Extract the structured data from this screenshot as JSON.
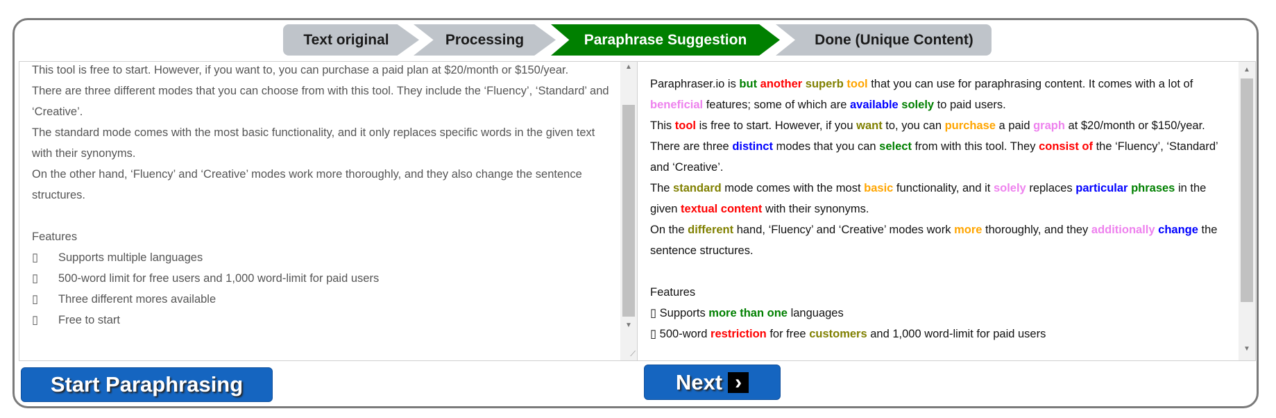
{
  "steps": [
    "Text original",
    "Processing",
    "Paraphrase Suggestion",
    "Done (Unique Content)"
  ],
  "active_step": 2,
  "colors": {
    "green": "#008000",
    "red": "#ff0000",
    "olive": "#808000",
    "orange": "#ffa500",
    "violet": "#ee82ee",
    "blue": "#0000ff",
    "step_active": "#008000",
    "step_inactive": "#bfc4ca",
    "button": "#1565c0"
  },
  "bullet_glyph": "▯",
  "left": {
    "paragraphs": [
      "This tool is free to start. However, if you want to, you can purchase a paid plan at $20/month or $150/year.",
      "There are three different modes that you can choose from with this tool. They include the ‘Fluency’, ‘Standard’ and ‘Creative’.",
      "The standard mode comes with the most basic functionality, and it only replaces specific words in the given text with their synonyms.",
      "On the other hand, ‘Fluency’ and ‘Creative’ modes work more thoroughly, and they also change the sentence structures."
    ],
    "features_heading": "Features",
    "features": [
      "Supports multiple languages",
      "500-word limit for free users and 1,000 word-limit for paid users",
      "Three different mores available",
      "Free to start"
    ],
    "scroll_position": 0.85
  },
  "right": {
    "paragraphs": [
      [
        {
          "t": "Paraphraser.io is "
        },
        {
          "t": "but",
          "c": "green"
        },
        {
          "t": " "
        },
        {
          "t": "another",
          "c": "red"
        },
        {
          "t": " "
        },
        {
          "t": "superb",
          "c": "olive"
        },
        {
          "t": " "
        },
        {
          "t": "tool",
          "c": "orange"
        },
        {
          "t": " that you can use for paraphrasing content. It comes with a lot of "
        },
        {
          "t": "beneficial",
          "c": "violet"
        },
        {
          "t": " features; some of which are "
        },
        {
          "t": "available",
          "c": "blue"
        },
        {
          "t": " "
        },
        {
          "t": "solely",
          "c": "green"
        },
        {
          "t": " to paid users."
        }
      ],
      [
        {
          "t": "This "
        },
        {
          "t": "tool",
          "c": "red"
        },
        {
          "t": " is free to start. However, if you "
        },
        {
          "t": "want",
          "c": "olive"
        },
        {
          "t": " to, you can "
        },
        {
          "t": "purchase",
          "c": "orange"
        },
        {
          "t": " a paid "
        },
        {
          "t": "graph",
          "c": "violet"
        },
        {
          "t": " at $20/month or $150/year."
        }
      ],
      [
        {
          "t": "There are three "
        },
        {
          "t": "distinct",
          "c": "blue"
        },
        {
          "t": " modes that you can "
        },
        {
          "t": "select",
          "c": "green"
        },
        {
          "t": " from with this tool. They "
        },
        {
          "t": "consist of",
          "c": "red"
        },
        {
          "t": " the ‘Fluency’, ‘Standard’ and ‘Creative’."
        }
      ],
      [
        {
          "t": "The "
        },
        {
          "t": "standard",
          "c": "olive"
        },
        {
          "t": " mode comes with the most "
        },
        {
          "t": "basic",
          "c": "orange"
        },
        {
          "t": " functionality, and it "
        },
        {
          "t": "solely",
          "c": "violet"
        },
        {
          "t": " replaces "
        },
        {
          "t": "particular",
          "c": "blue"
        },
        {
          "t": " "
        },
        {
          "t": "phrases",
          "c": "green"
        },
        {
          "t": " in the given "
        },
        {
          "t": "textual content",
          "c": "red"
        },
        {
          "t": " with their synonyms."
        }
      ],
      [
        {
          "t": "On the "
        },
        {
          "t": "different",
          "c": "olive"
        },
        {
          "t": " hand, ‘Fluency’ and ‘Creative’ modes work "
        },
        {
          "t": "more",
          "c": "orange"
        },
        {
          "t": " thoroughly, and they "
        },
        {
          "t": "additionally",
          "c": "violet"
        },
        {
          "t": " "
        },
        {
          "t": "change",
          "c": "blue"
        },
        {
          "t": " the sentence structures."
        }
      ]
    ],
    "features_heading": "Features",
    "features": [
      [
        {
          "t": "Supports "
        },
        {
          "t": "more than one",
          "c": "green"
        },
        {
          "t": " languages"
        }
      ],
      [
        {
          "t": "500-word "
        },
        {
          "t": "restriction",
          "c": "red"
        },
        {
          "t": " for free "
        },
        {
          "t": "customers",
          "c": "olive"
        },
        {
          "t": " and 1,000 word-limit for paid users"
        }
      ]
    ],
    "scroll_position": 0.0
  },
  "buttons": {
    "start": "Start Paraphrasing",
    "next": "Next"
  }
}
